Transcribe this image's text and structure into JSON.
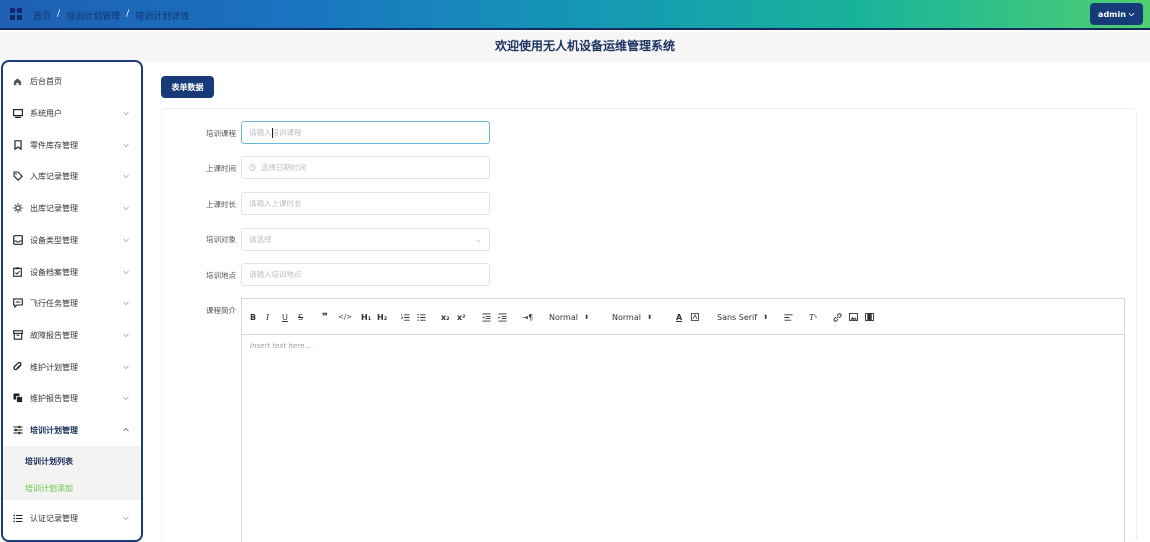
{
  "breadcrumb": {
    "items": [
      "首页",
      "培训计划管理",
      "培训计划详情"
    ],
    "separator": "/"
  },
  "user_menu": {
    "label": "admin",
    "chevron": "chevron-down-icon"
  },
  "header": {
    "title": "欢迎使用无人机设备运维管理系统"
  },
  "sidebar": {
    "items": [
      {
        "label": "后台首页",
        "icon": "home-icon"
      },
      {
        "label": "系统用户",
        "icon": "monitor-icon"
      },
      {
        "label": "零件库存管理",
        "icon": "bookmark-icon"
      },
      {
        "label": "入库记录管理",
        "icon": "tag-icon"
      },
      {
        "label": "出库记录管理",
        "icon": "sun-icon"
      },
      {
        "label": "设备类型管理",
        "icon": "inbox-icon"
      },
      {
        "label": "设备档案管理",
        "icon": "clipboard-check-icon"
      },
      {
        "label": "飞行任务管理",
        "icon": "message-icon"
      },
      {
        "label": "故障报告管理",
        "icon": "archive-icon"
      },
      {
        "label": "维护计划管理",
        "icon": "paperclip-icon"
      },
      {
        "label": "维护报告管理",
        "icon": "copy-icon"
      },
      {
        "label": "培训计划管理",
        "icon": "sliders-icon"
      },
      {
        "label": "认证记录管理",
        "icon": "list-icon"
      }
    ],
    "sub_items": [
      {
        "label": "培训计划列表"
      },
      {
        "label": "培训计划添加"
      }
    ],
    "active_color": "#67c23a"
  },
  "form": {
    "tag_label": "表单数据",
    "fields": [
      {
        "label": "培训课程",
        "placeholder": "请输入培训课程"
      },
      {
        "label": "上课时间",
        "placeholder": "选择日期时间"
      },
      {
        "label": "上课时长",
        "placeholder": "请输入上课时长"
      },
      {
        "label": "培训对象",
        "placeholder": "请选择"
      },
      {
        "label": "培训地点",
        "placeholder": "请输入培训地点"
      }
    ],
    "editor": {
      "label": "课程简介",
      "placeholder": "Insert text here ...",
      "toolbar": {
        "header1": "H₁",
        "header2": "H₂",
        "sub": "x₂",
        "sup": "x²",
        "size": "Normal",
        "header": "Normal",
        "font": "Sans Serif"
      }
    }
  },
  "colors": {
    "accent": "#173a78",
    "focus_border": "#6ab6da",
    "topbar_start": "#1f5fb3",
    "topbar_end": "#4fcf72"
  }
}
